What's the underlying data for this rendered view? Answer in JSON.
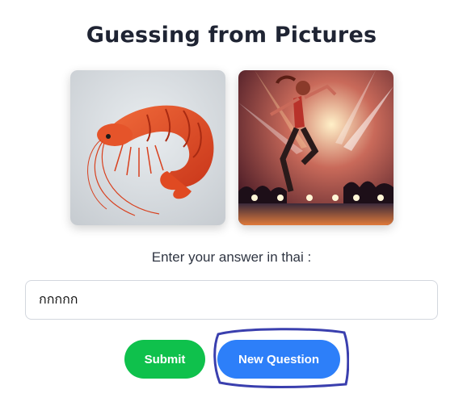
{
  "title": "Guessing from Pictures",
  "images": [
    {
      "subject": "shrimp"
    },
    {
      "subject": "dancer"
    }
  ],
  "prompt": "Enter your answer in thai :",
  "answer": {
    "value": "กกกกก",
    "placeholder": ""
  },
  "buttons": {
    "submit": "Submit",
    "new_question": "New Question"
  },
  "colors": {
    "title": "#1f2433",
    "submit_bg": "#0fc14c",
    "new_question_bg": "#2d7ff9",
    "annotation": "#3a3fae"
  }
}
